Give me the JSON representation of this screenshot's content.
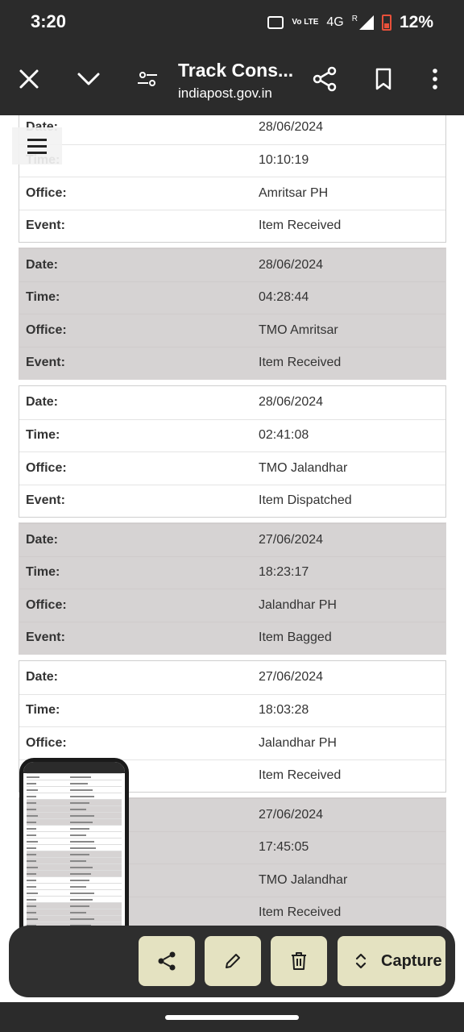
{
  "status_bar": {
    "time": "3:20",
    "network": "4G",
    "volte": "Vo LTE",
    "roaming": "R",
    "battery_percent": "12%"
  },
  "toolbar": {
    "title": "Track Cons...",
    "url": "indiapost.gov.in",
    "icons": [
      "close-icon",
      "chevron-down-icon",
      "page-settings-icon",
      "share-icon",
      "bookmark-icon",
      "more-icon"
    ]
  },
  "partial_top": {
    "rows": [
      {
        "label": "Date:",
        "value": "28/06/2024"
      },
      {
        "label": "Time:",
        "value": "10:10:19"
      },
      {
        "label": "Office:",
        "value": "Amritsar PH"
      },
      {
        "label": "Event:",
        "value": "Item Received"
      }
    ]
  },
  "events": [
    {
      "shaded": true,
      "date": "28/06/2024",
      "time": "04:28:44",
      "office": "TMO Amritsar",
      "event": "Item Received"
    },
    {
      "shaded": false,
      "date": "28/06/2024",
      "time": "02:41:08",
      "office": "TMO Jalandhar",
      "event": "Item Dispatched"
    },
    {
      "shaded": true,
      "date": "27/06/2024",
      "time": "18:23:17",
      "office": "Jalandhar PH",
      "event": "Item Bagged"
    },
    {
      "shaded": false,
      "date": "27/06/2024",
      "time": "18:03:28",
      "office": "Jalandhar PH",
      "event": "Item Received"
    },
    {
      "shaded": true,
      "date": "27/06/2024",
      "time": "17:45:05",
      "office": "TMO Jalandhar",
      "event": "Item Received"
    }
  ],
  "labels": {
    "date": "Date:",
    "time": "Time:",
    "office": "Office:",
    "event": "Event:"
  },
  "capture_bar": {
    "capture_label": "Capture"
  }
}
